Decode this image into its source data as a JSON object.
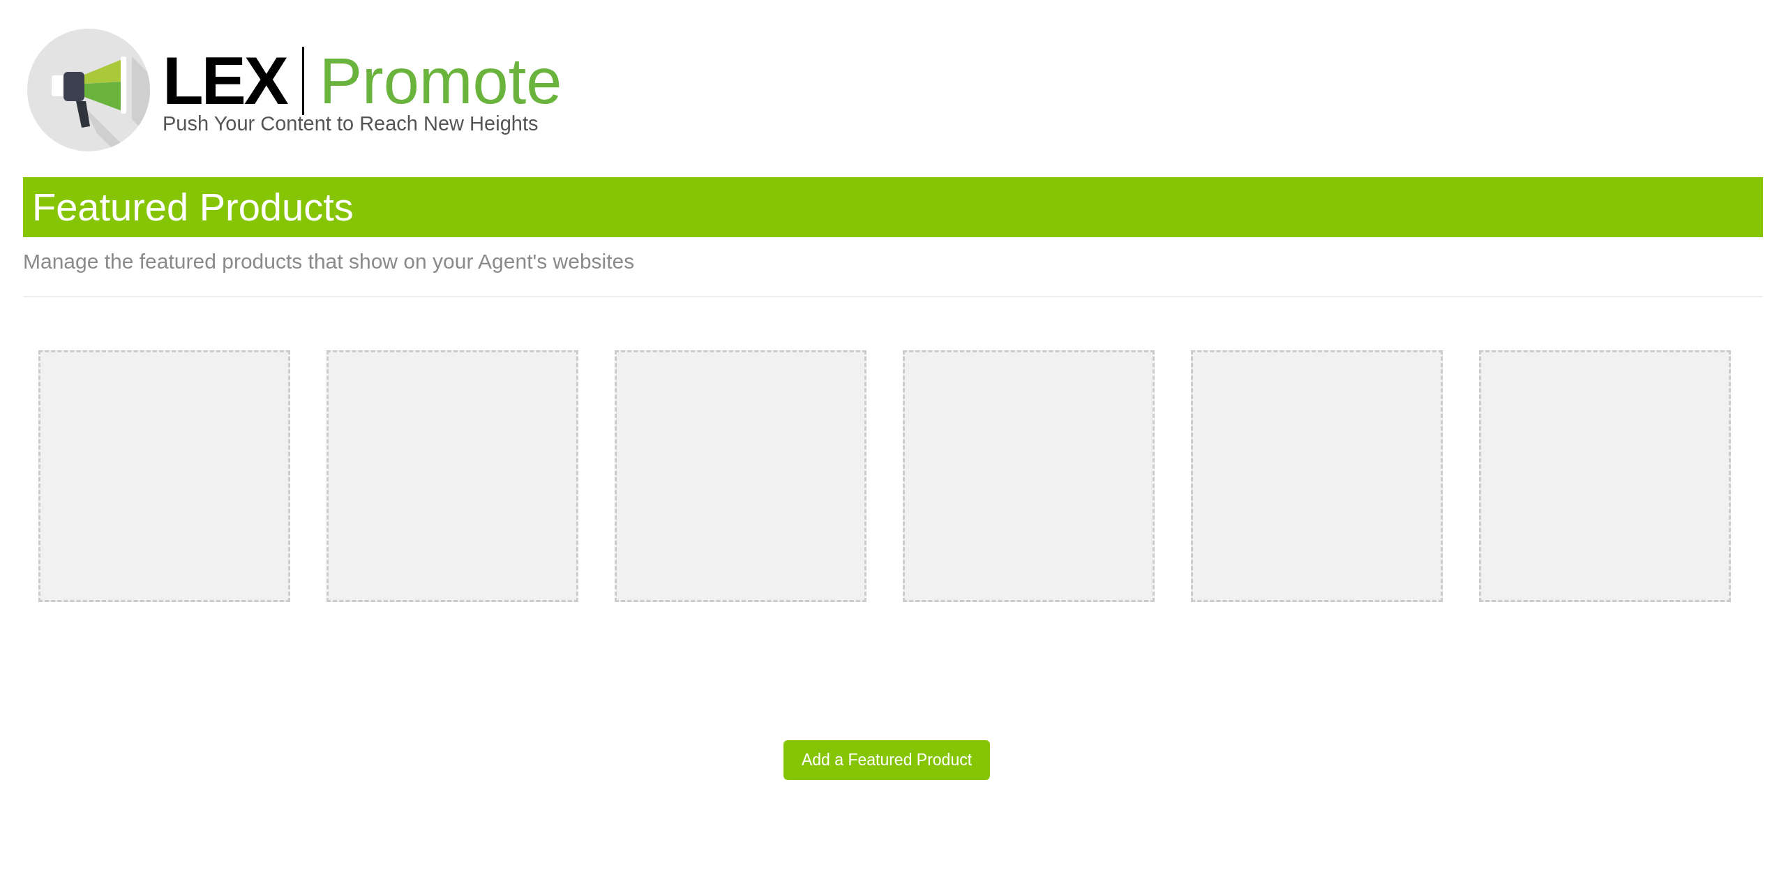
{
  "logo": {
    "brand": "LEX",
    "product": "Promote",
    "tagline": "Push Your Content to Reach New Heights"
  },
  "header": {
    "title": "Featured Products",
    "subtitle": "Manage the featured products that show on your Agent's websites"
  },
  "product_slots": [
    {
      "kind": "empty"
    },
    {
      "kind": "empty"
    },
    {
      "kind": "empty"
    },
    {
      "kind": "empty"
    },
    {
      "kind": "empty"
    },
    {
      "kind": "empty"
    }
  ],
  "add_button": {
    "label": "Add a Featured Product"
  }
}
